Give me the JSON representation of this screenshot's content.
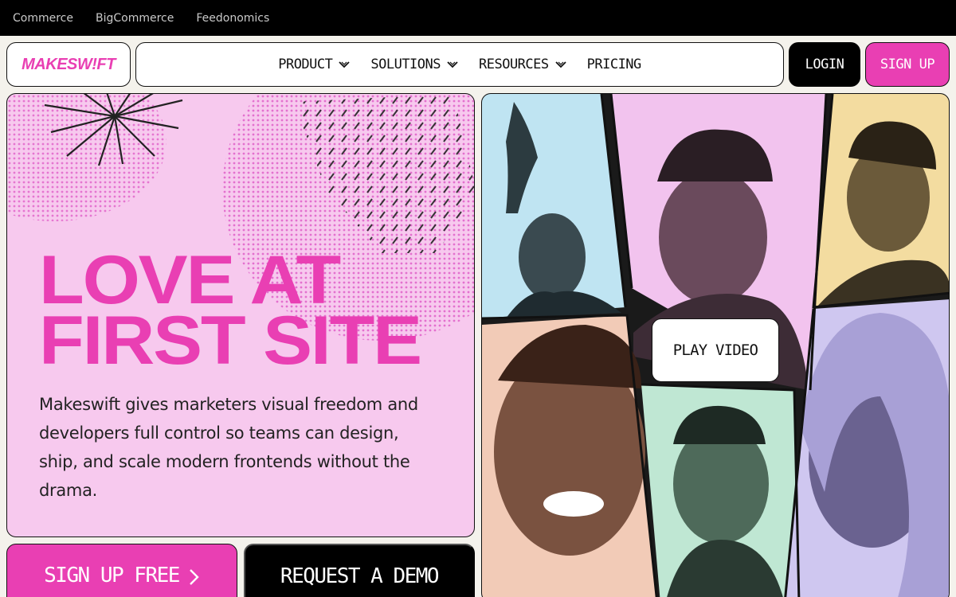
{
  "topbar": {
    "links": [
      "Commerce",
      "BigCommerce",
      "Feedonomics"
    ]
  },
  "header": {
    "logo": "MAKESW!FT",
    "nav": [
      {
        "label": "PRODUCT",
        "has_dropdown": true
      },
      {
        "label": "SOLUTIONS",
        "has_dropdown": true
      },
      {
        "label": "RESOURCES",
        "has_dropdown": true
      },
      {
        "label": "PRICING",
        "has_dropdown": false
      }
    ],
    "login_label": "LOGIN",
    "signup_label": "SIGN UP"
  },
  "hero": {
    "headline_line1": "LOVE AT",
    "headline_line2": "FIRST SITE",
    "subtext": "Makeswift gives marketers visual freedom and developers full control so teams can design, ship, and scale modern frontends without the drama.",
    "cta_primary": "SIGN UP FREE",
    "cta_secondary": "REQUEST A DEMO",
    "play_video_label": "PLAY VIDEO"
  },
  "icons": {
    "nav_dropdown": "chevron-down-icon",
    "cta_arrow": "chevron-right-icon",
    "burst": "starburst-icon"
  },
  "colors": {
    "brand_pink": "#e93fb3",
    "hero_bg": "#f7c9ee",
    "topbar_bg": "#000000",
    "page_bg": "#f4f2ec"
  }
}
